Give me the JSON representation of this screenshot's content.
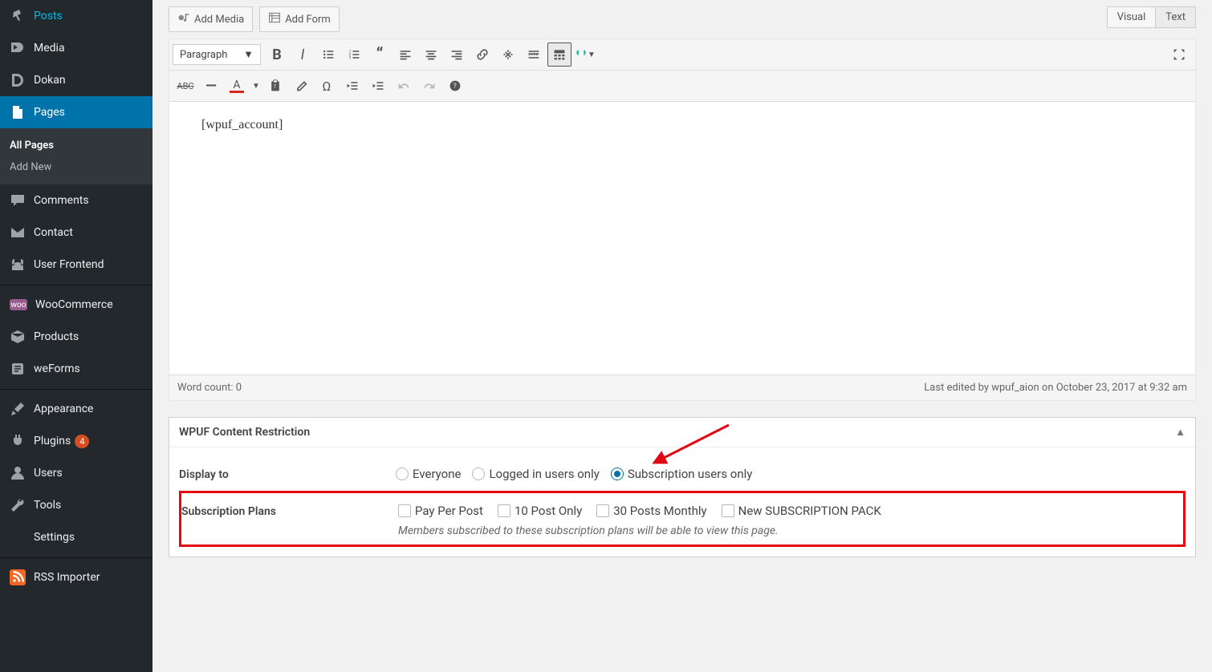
{
  "sidebar": {
    "items": [
      {
        "label": "Posts",
        "icon": "pin"
      },
      {
        "label": "Media",
        "icon": "media"
      },
      {
        "label": "Dokan",
        "icon": "dokan"
      },
      {
        "label": "Pages",
        "icon": "page",
        "active": true
      },
      {
        "label": "Comments",
        "icon": "comment"
      },
      {
        "label": "Contact",
        "icon": "mail"
      },
      {
        "label": "User Frontend",
        "icon": "uf"
      },
      {
        "label": "WooCommerce",
        "icon": "woo"
      },
      {
        "label": "Products",
        "icon": "product"
      },
      {
        "label": "weForms",
        "icon": "weforms"
      },
      {
        "label": "Appearance",
        "icon": "brush"
      },
      {
        "label": "Plugins",
        "icon": "plugin",
        "badge": "4"
      },
      {
        "label": "Users",
        "icon": "user"
      },
      {
        "label": "Tools",
        "icon": "wrench"
      },
      {
        "label": "Settings",
        "icon": "settings"
      },
      {
        "label": "RSS Importer",
        "icon": "rss"
      }
    ],
    "submenu": [
      {
        "label": "All Pages",
        "current": true
      },
      {
        "label": "Add New"
      }
    ]
  },
  "buttons": {
    "add_media": "Add Media",
    "add_form": "Add Form"
  },
  "tabs": {
    "visual": "Visual",
    "text": "Text"
  },
  "editor": {
    "format": "Paragraph",
    "content": "[wpuf_account]",
    "word_count": "Word count: 0",
    "last_edited": "Last edited by wpuf_aion on October 23, 2017 at 9:32 am"
  },
  "metabox": {
    "title": "WPUF Content Restriction",
    "display_to_label": "Display to",
    "radios": {
      "everyone": "Everyone",
      "logged_in": "Logged in users only",
      "subscription": "Subscription users only"
    },
    "plans_label": "Subscription Plans",
    "plans": [
      "Pay Per Post",
      "10 Post Only",
      "30 Posts Monthly",
      "New SUBSCRIPTION PACK"
    ],
    "plans_desc": "Members subscribed to these subscription plans will be able to view this page."
  }
}
